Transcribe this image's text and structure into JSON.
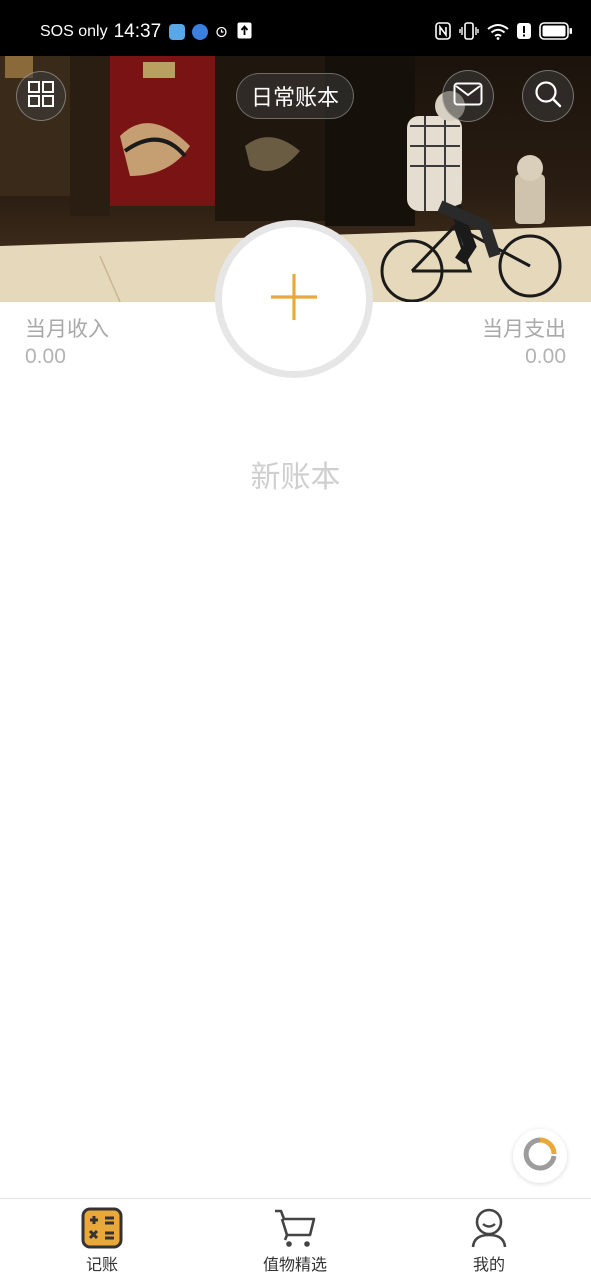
{
  "status_bar": {
    "carrier": "SOS only",
    "time": "14:37"
  },
  "header": {
    "book_selector_label": "日常账本",
    "left_icon": "grid-icon",
    "right_icons": [
      "mail-icon",
      "search-icon"
    ]
  },
  "stats": {
    "income_label": "当月收入",
    "income_value": "0.00",
    "expense_label": "当月支出",
    "expense_value": "0.00"
  },
  "main": {
    "book_name": "新账本",
    "add_icon": "plus-icon"
  },
  "tabs": [
    {
      "label": "记账",
      "icon": "calculator-icon",
      "active": true
    },
    {
      "label": "值物精选",
      "icon": "cart-icon",
      "active": false
    },
    {
      "label": "我的",
      "icon": "user-icon",
      "active": false
    }
  ],
  "colors": {
    "accent": "#e8a93a",
    "muted_text": "#a9a9a9",
    "placeholder_text": "#cfcfcf"
  }
}
